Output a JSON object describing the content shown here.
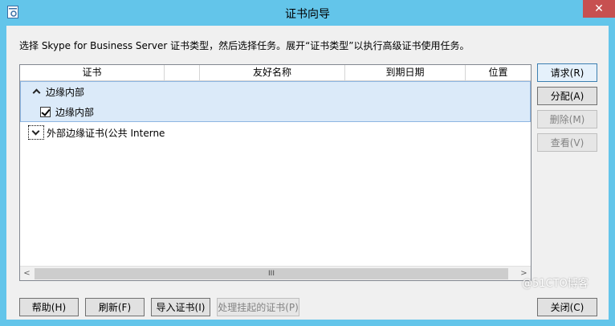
{
  "window": {
    "title": "证书向导",
    "close_glyph": "✕"
  },
  "instruction": "选择 Skype for Business Server 证书类型，然后选择任务。展开“证书类型”以执行高级证书使用任务。",
  "grid": {
    "columns": [
      "证书",
      "",
      "友好名称",
      "到期日期",
      "位置"
    ],
    "group": {
      "label": "边缘内部",
      "expanded": true,
      "child_label": "边缘内部",
      "checked": true
    },
    "collapsed_row": {
      "label": "外部边缘证书(公共 Interne"
    },
    "scroll_thumb_glyph": "III",
    "scroll_left": "<",
    "scroll_right": ">"
  },
  "side_buttons": {
    "request": "请求(R)",
    "assign": "分配(A)",
    "remove": "删除(M)",
    "view": "查看(V)"
  },
  "bottom_buttons": {
    "help": "帮助(H)",
    "refresh": "刷新(F)",
    "import": "导入证书(I)",
    "pending": "处理挂起的证书(P)",
    "close": "关闭(C)"
  },
  "watermark": "@51CTO博客"
}
